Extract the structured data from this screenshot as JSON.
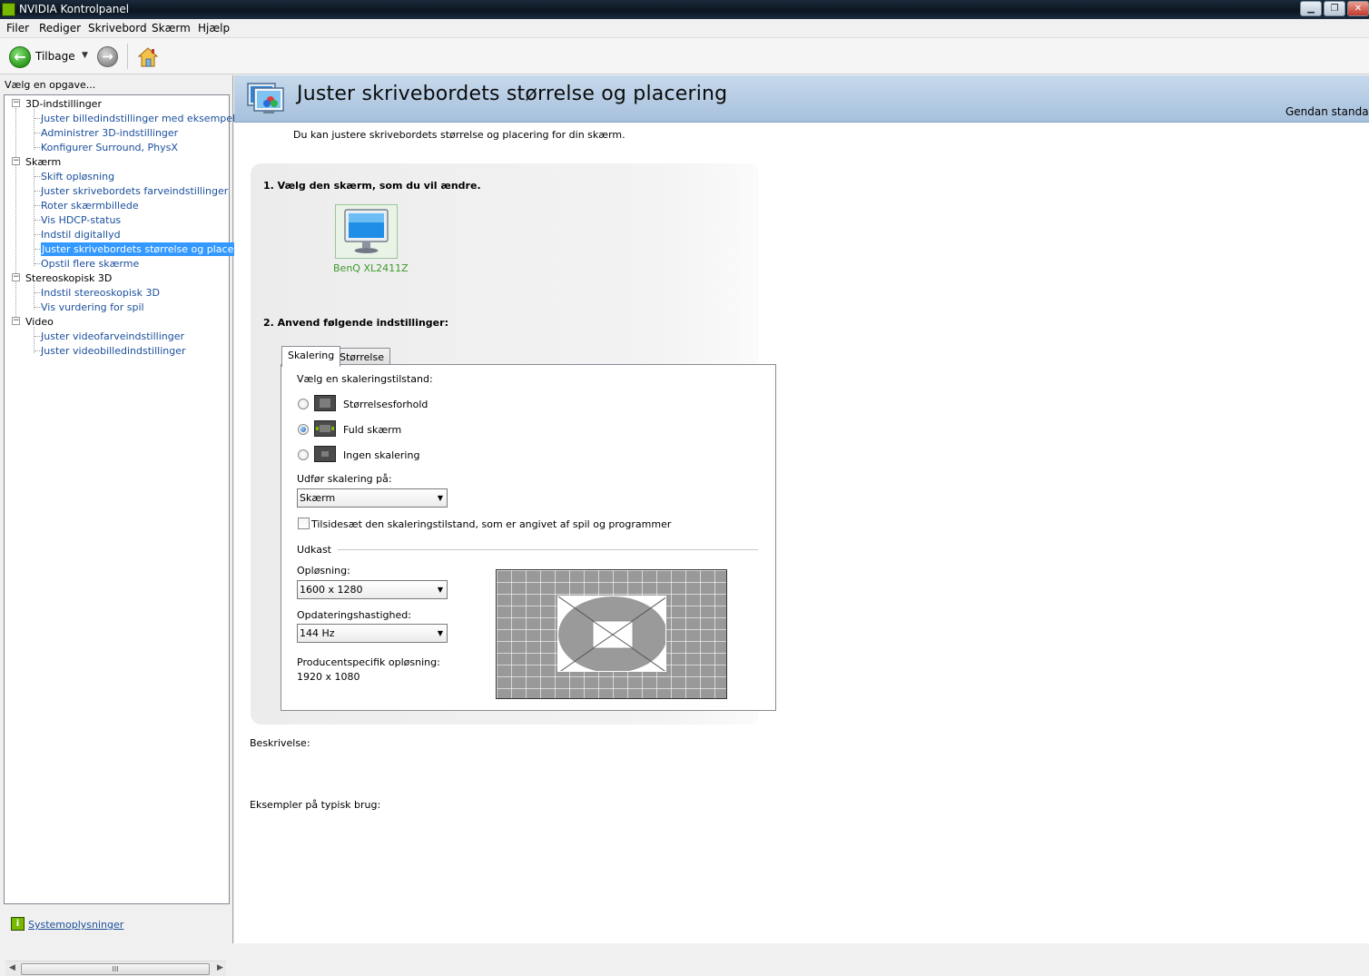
{
  "window": {
    "title": "NVIDIA Kontrolpanel",
    "minimize": "▁",
    "maximize": "❐",
    "close": "✕"
  },
  "menu": [
    "Filer",
    "Rediger",
    "Skrivebord",
    "Skærm",
    "Hjælp"
  ],
  "toolbar": {
    "back_label": "Tilbage"
  },
  "sidebar": {
    "task_label": "Vælg en opgave...",
    "groups": [
      {
        "label": "3D-indstillinger",
        "items": [
          "Juster billedindstillinger med eksempel",
          "Administrer 3D-indstillinger",
          "Konfigurer Surround, PhysX"
        ]
      },
      {
        "label": "Skærm",
        "items": [
          "Skift opløsning",
          "Juster skrivebordets farveindstillinger",
          "Roter skærmbillede",
          "Vis HDCP-status",
          "Indstil digitallyd",
          "Juster skrivebordets størrelse og placering",
          "Opstil flere skærme"
        ]
      },
      {
        "label": "Stereoskopisk 3D",
        "items": [
          "Indstil stereoskopisk 3D",
          "Vis vurdering for spil"
        ]
      },
      {
        "label": "Video",
        "items": [
          "Juster videofarveindstillinger",
          "Juster videobilledindstillinger"
        ]
      }
    ],
    "selected_item": "Juster skrivebordets størrelse og placering",
    "scroll_grip": "III",
    "sysinfo_link": "Systemoplysninger"
  },
  "main": {
    "title": "Juster skrivebordets størrelse og placering",
    "restore_link": "Gendan standard",
    "intro": "Du kan justere skrivebordets størrelse og placering for din skærm.",
    "step1": "1. Vælg den skærm, som du vil ændre.",
    "monitor_name": "BenQ XL2411Z",
    "step2": "2. Anvend følgende indstillinger:",
    "tabs": [
      "Skalering",
      "Størrelse"
    ],
    "active_tab": "Skalering",
    "scaling_mode_label": "Vælg en skaleringstilstand:",
    "scaling_modes": [
      {
        "label": "Størrelsesforhold",
        "checked": false
      },
      {
        "label": "Fuld skærm",
        "checked": true
      },
      {
        "label": "Ingen skalering",
        "checked": false
      }
    ],
    "perform_scaling_label": "Udfør skalering på:",
    "perform_scaling_value": "Skærm",
    "override_checkbox_label": "Tilsidesæt den skaleringstilstand, som er angivet af spil og programmer",
    "override_checked": false,
    "preview_section": "Udkast",
    "resolution_label": "Opløsning:",
    "resolution_value": "1600 x 1280",
    "refresh_label": "Opdateringshastighed:",
    "refresh_value": "144 Hz",
    "native_label": "Producentspecifik opløsning:",
    "native_value": "1920 x 1080",
    "description_label": "Beskrivelse:",
    "examples_label": "Eksempler på typisk brug:"
  },
  "colors": {
    "link": "#1a4f9c",
    "selection": "#3399ff",
    "nvidia_green": "#76b900",
    "header_band": "#b3cbe3"
  }
}
